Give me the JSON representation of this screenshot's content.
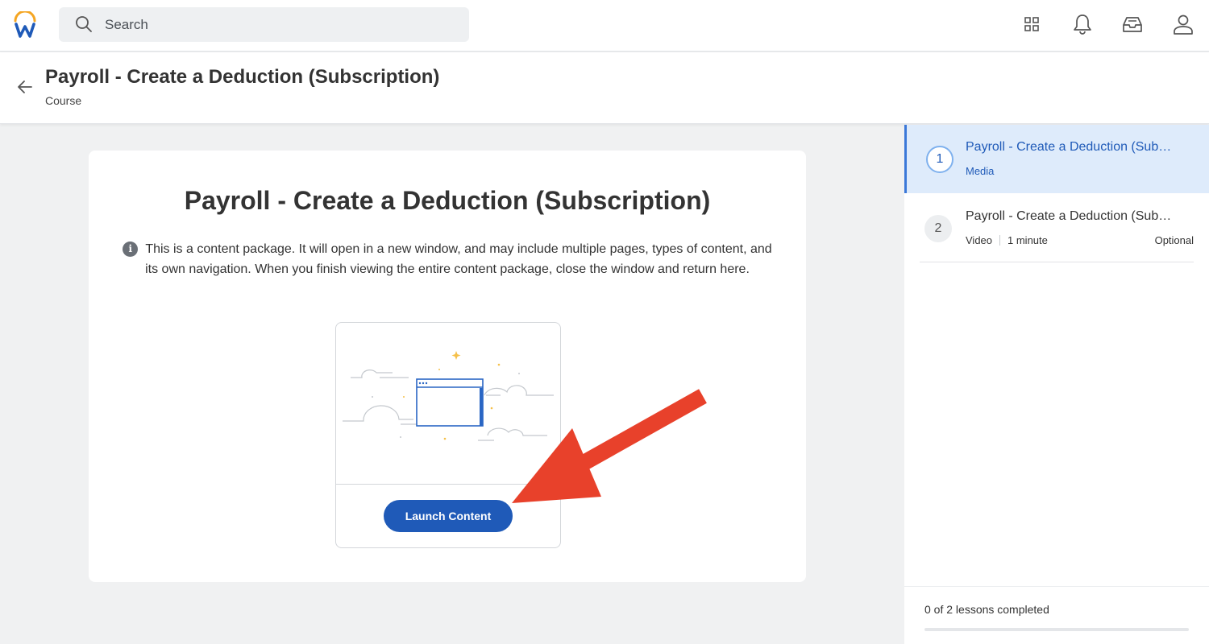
{
  "header": {
    "search_placeholder": "Search",
    "icons": [
      "apps-grid-icon",
      "bell-icon",
      "inbox-icon",
      "user-icon"
    ]
  },
  "page": {
    "title": "Payroll - Create a Deduction (Subscription)",
    "subtitle": "Course"
  },
  "content": {
    "title": "Payroll - Create a Deduction (Subscription)",
    "description": "This is a content package. It will open in a new window, and may include multiple pages, types of content, and its own navigation. When you finish viewing the entire content package, close the window and return here.",
    "launch_label": "Launch Content"
  },
  "lessons": [
    {
      "number": "1",
      "title": "Payroll - Create a Deduction (Subscription)",
      "type": "Media",
      "active": true
    },
    {
      "number": "2",
      "title": "Payroll - Create a Deduction (Subscription)",
      "type": "Video",
      "duration": "1 minute",
      "tag": "Optional",
      "active": false
    }
  ],
  "progress": {
    "text": "0 of 2 lessons completed",
    "completed": 0,
    "total": 2
  },
  "colors": {
    "accent": "#1f5ab8",
    "active_row": "#deebfb",
    "annotation_arrow": "#e8412b"
  }
}
